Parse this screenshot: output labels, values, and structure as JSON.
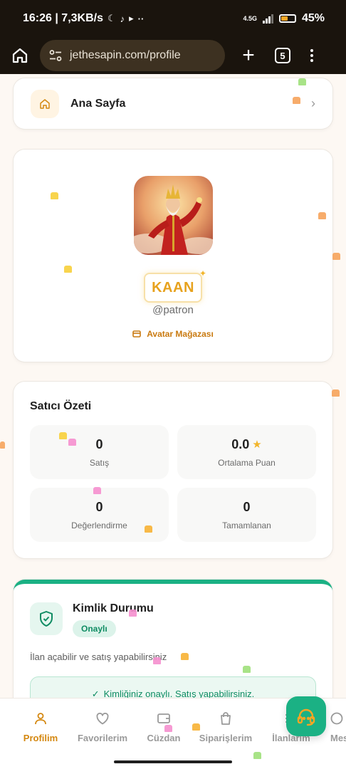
{
  "status_bar": {
    "time_speed": "16:26 | 7,3KB/s",
    "network": "4.5G",
    "battery": "45%"
  },
  "browser": {
    "url": "jethesapin.com/profile",
    "tab_count": "5"
  },
  "home_link": {
    "label": "Ana Sayfa"
  },
  "profile": {
    "display_name": "KAAN",
    "username": "@patron",
    "avatar_store_label": "Avatar Mağazası"
  },
  "seller_summary": {
    "title": "Satıcı Özeti",
    "stats": [
      {
        "value": "0",
        "label": "Satış"
      },
      {
        "value": "0.0",
        "label": "Ortalama Puan"
      },
      {
        "value": "0",
        "label": "Değerlendirme"
      },
      {
        "value": "0",
        "label": "Tamamlanan"
      }
    ]
  },
  "identity": {
    "title": "Kimlik Durumu",
    "badge": "Onaylı",
    "description": "İlan açabilir ve satış yapabilirsiniz",
    "verified_message": "Kimliğiniz onaylı. Satış yapabilirsiniz."
  },
  "bottom_nav": {
    "items": [
      {
        "label": "Profilim",
        "icon": "user-icon",
        "active": true
      },
      {
        "label": "Favorilerim",
        "icon": "heart-icon",
        "active": false
      },
      {
        "label": "Cüzdan",
        "icon": "wallet-icon",
        "active": false
      },
      {
        "label": "Siparişlerim",
        "icon": "bag-icon",
        "active": false
      },
      {
        "label": "İlanlarım",
        "icon": "list-icon",
        "active": false
      },
      {
        "label": "Mes",
        "icon": "message-icon",
        "active": false
      }
    ]
  },
  "colors": {
    "accent_orange": "#d4870f",
    "accent_green": "#1bb184",
    "gold": "#e7a21e"
  }
}
